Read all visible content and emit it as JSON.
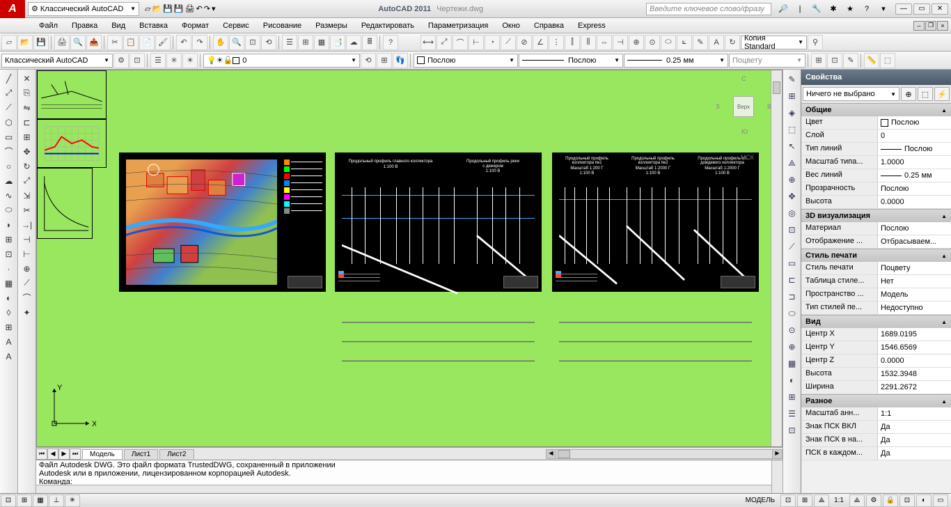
{
  "title": {
    "app": "AutoCAD 2011",
    "file": "Чертежи.dwg"
  },
  "workspace": "Классический AutoCAD",
  "search_placeholder": "Введите ключевое слово/фразу",
  "menu": [
    "Файл",
    "Правка",
    "Вид",
    "Вставка",
    "Формат",
    "Сервис",
    "Рисование",
    "Размеры",
    "Редактировать",
    "Параметризация",
    "Окно",
    "Справка",
    "Express"
  ],
  "row2": {
    "workspace2": "Классический AutoCAD",
    "layer": "0",
    "color": "Послою",
    "linetype": "Послою",
    "lineweight": "0.25 мм",
    "plotstyle": "Поцвету",
    "textstyle": "Копия Standard"
  },
  "tabs": {
    "model": "Модель",
    "l1": "Лист1",
    "l2": "Лист2"
  },
  "viewcube": {
    "top": "Верх",
    "n": "С",
    "s": "Ю",
    "e": "В",
    "w": "З"
  },
  "wcs": "МСК",
  "sheets": {
    "s2a": "Продольный профиль главного коллектора",
    "s2b": "Продольный профиль реки",
    "s2b2": "с дюкером",
    "s2scale": "1:100 В",
    "s3a": "Продольный профиль коллектора №1",
    "s3b": "Продольный профиль коллектора №2",
    "s3c": "Продольный профиль гл. дождевого коллектора",
    "s3scale1": "Масштаб 1:200 Г",
    "s3scale2": "Масштаб 1:2000 Г",
    "s3v": "1:100 В"
  },
  "cmd": {
    "l1": "Файл Autodesk DWG. Это файл формата TrustedDWG, сохраненный в приложении",
    "l2": "Autodesk или в приложении, лицензированном корпорацией Autodesk.",
    "prompt": "Команда:"
  },
  "props": {
    "title": "Свойства",
    "selection": "Ничего не выбрано",
    "sections": {
      "general": "Общие",
      "viz3d": "3D визуализация",
      "plot": "Стиль печати",
      "view": "Вид",
      "misc": "Разное"
    },
    "rows": {
      "color_k": "Цвет",
      "color_v": "Послою",
      "layer_k": "Слой",
      "layer_v": "0",
      "ltype_k": "Тип линий",
      "ltype_v": "Послою",
      "ltscale_k": "Масштаб типа...",
      "ltscale_v": "1.0000",
      "lweight_k": "Вес линий",
      "lweight_v": "0.25 мм",
      "transp_k": "Прозрачность",
      "transp_v": "Послою",
      "thick_k": "Высота",
      "thick_v": "0.0000",
      "material_k": "Материал",
      "material_v": "Послою",
      "shadow_k": "Отображение ...",
      "shadow_v": "Отбрасываем...",
      "pstyle_k": "Стиль печати",
      "pstyle_v": "Поцвету",
      "pstable_k": "Таблица стиле...",
      "pstable_v": "Нет",
      "psspace_k": "Пространство ...",
      "psspace_v": "Модель",
      "pstype_k": "Тип стилей пе...",
      "pstype_v": "Недоступно",
      "cx_k": "Центр X",
      "cx_v": "1689.0195",
      "cy_k": "Центр Y",
      "cy_v": "1546.6569",
      "cz_k": "Центр Z",
      "cz_v": "0.0000",
      "vh_k": "Высота",
      "vh_v": "1532.3948",
      "vw_k": "Ширина",
      "vw_v": "2291.2672",
      "ann_k": "Масштаб анн...",
      "ann_v": "1:1",
      "ucs1_k": "Знак ПСК ВКЛ",
      "ucs1_v": "Да",
      "ucs2_k": "Знак ПСК в на...",
      "ucs2_v": "Да",
      "ucs3_k": "ПСК в каждом...",
      "ucs3_v": "Да"
    }
  },
  "status": {
    "model": "МОДЕЛЬ",
    "scale": "1:1"
  }
}
